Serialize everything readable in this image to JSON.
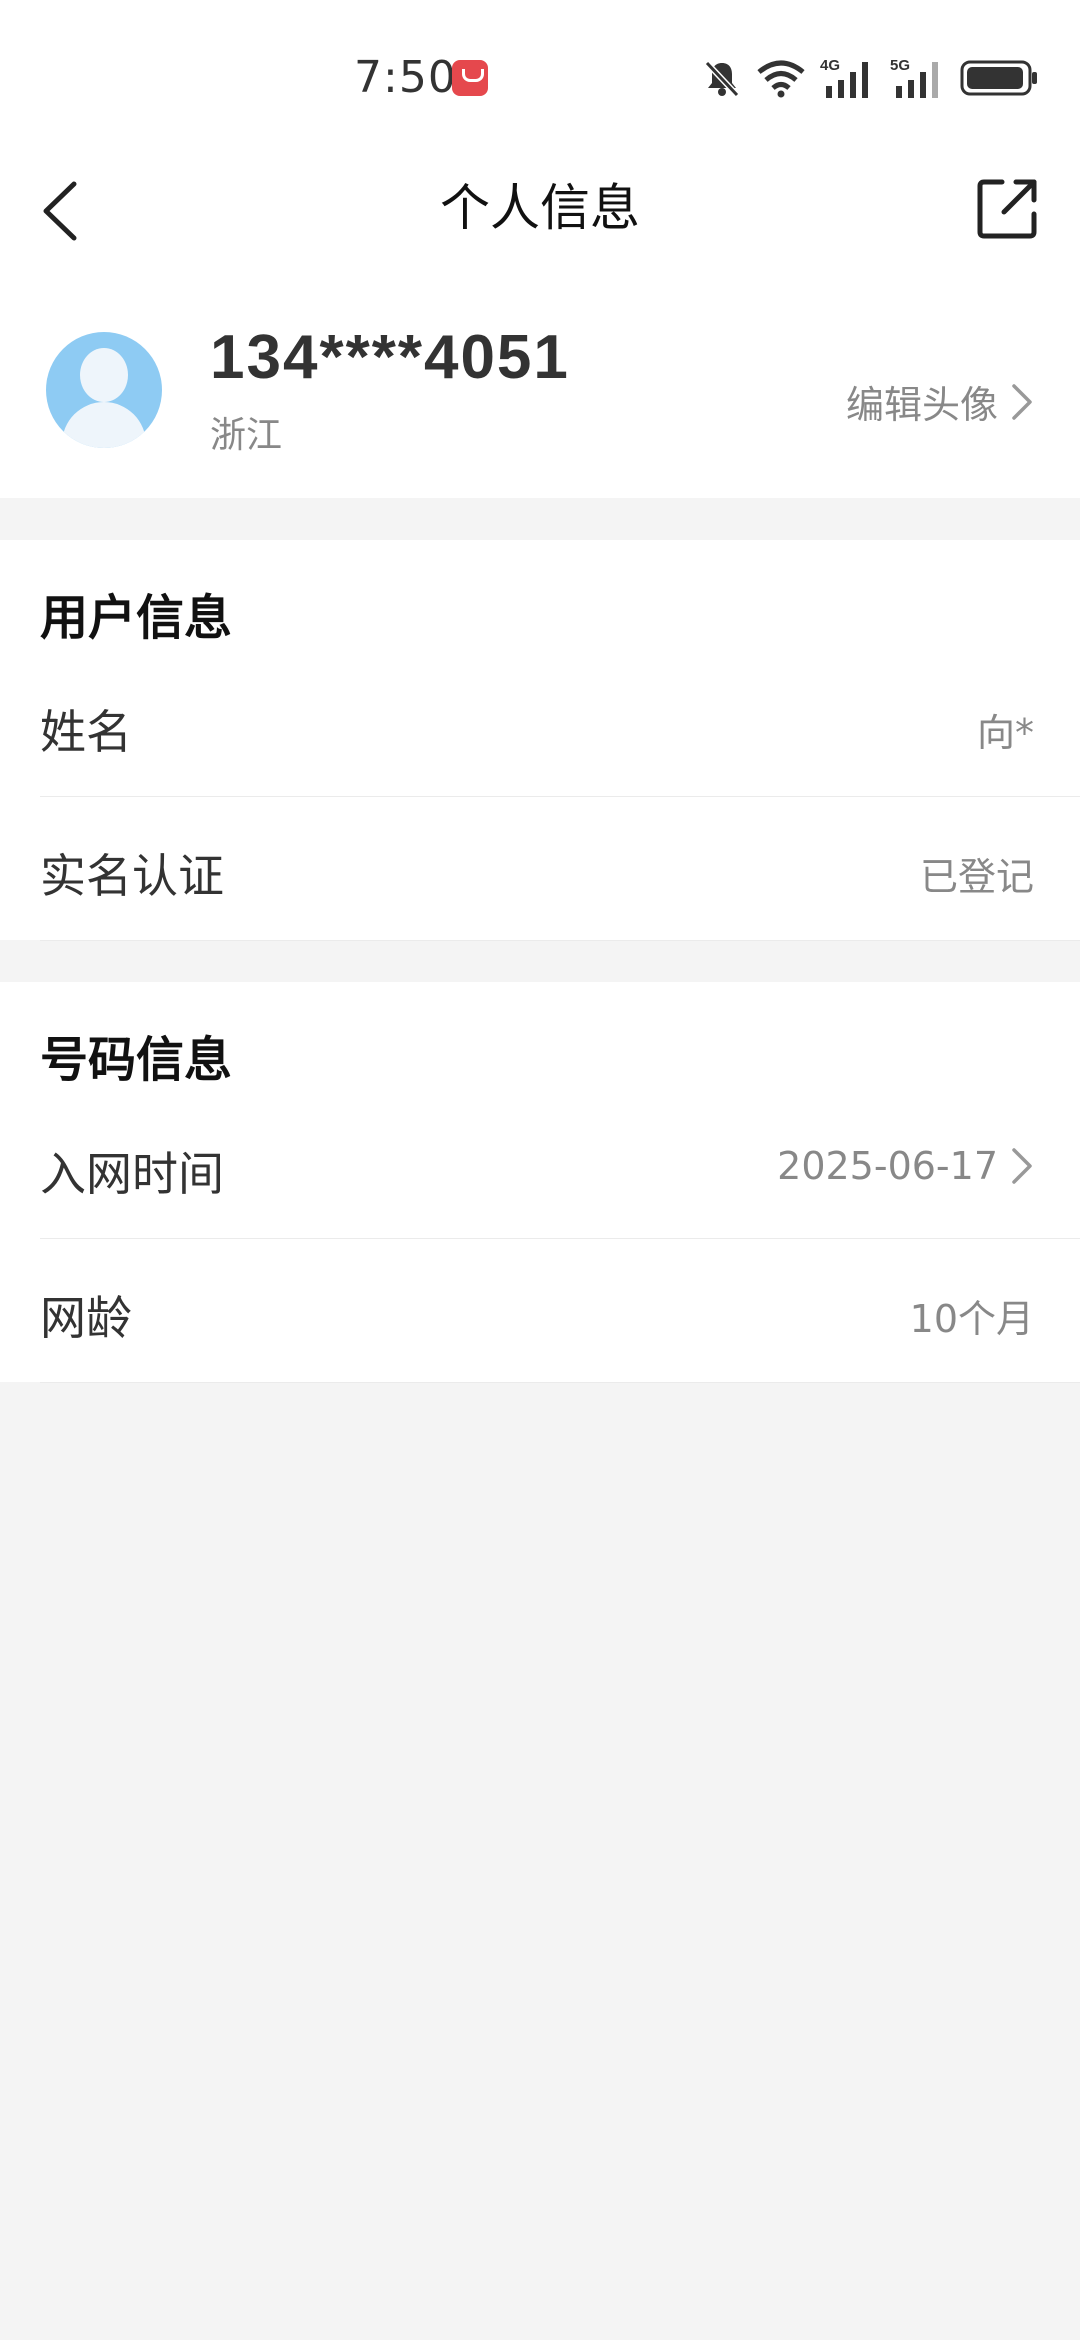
{
  "status_bar": {
    "time": "7:50",
    "icons": [
      "mute-icon",
      "wifi-icon",
      "signal-4g-icon",
      "signal-5g-icon",
      "battery-icon"
    ],
    "network_labels": [
      "4G",
      "5G"
    ]
  },
  "header": {
    "title": "个人信息"
  },
  "profile": {
    "phone": "134****4051",
    "region": "浙江",
    "edit_avatar_label": "编辑头像"
  },
  "user_info": {
    "title": "用户信息",
    "rows": [
      {
        "label": "姓名",
        "value": "向*"
      },
      {
        "label": "实名认证",
        "value": "已登记"
      }
    ]
  },
  "number_info": {
    "title": "号码信息",
    "rows": [
      {
        "label": "入网时间",
        "value": "2025-06-17"
      },
      {
        "label": "网龄",
        "value": "10个月"
      }
    ]
  },
  "colors": {
    "background": "#f4f4f4",
    "card": "#ffffff",
    "avatar": "#8ecbf3",
    "store_badge": "#e5484d"
  }
}
